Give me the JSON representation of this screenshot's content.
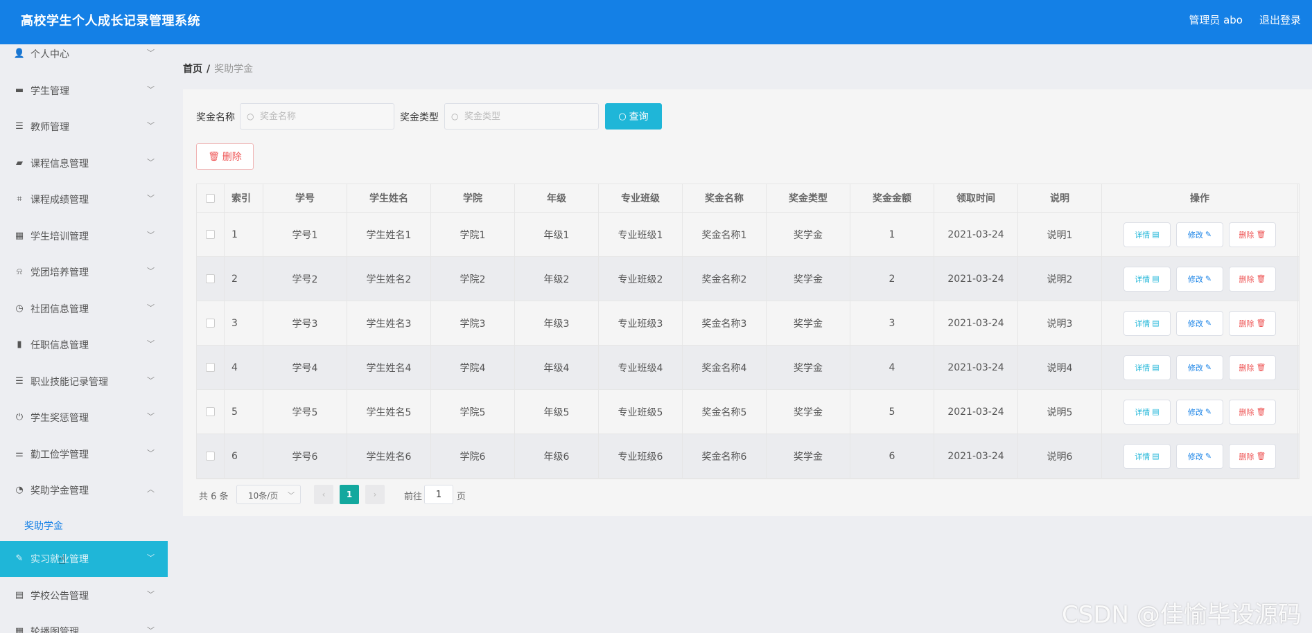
{
  "header": {
    "title": "高校学生个人成长记录管理系统",
    "user": "管理员 abo",
    "logout": "退出登录"
  },
  "sidebar": {
    "items": [
      {
        "label": "个人中心",
        "icon": "user-icon",
        "glyph": "👤",
        "chevron": "﹀"
      },
      {
        "label": "学生管理",
        "icon": "monitor-icon",
        "glyph": "▬",
        "chevron": "﹀"
      },
      {
        "label": "教师管理",
        "icon": "list-icon",
        "glyph": "☰",
        "chevron": "﹀"
      },
      {
        "label": "课程信息管理",
        "icon": "comment-icon",
        "glyph": "▰",
        "chevron": "﹀"
      },
      {
        "label": "课程成绩管理",
        "icon": "crop-icon",
        "glyph": "⌗",
        "chevron": "﹀"
      },
      {
        "label": "学生培训管理",
        "icon": "grid-icon",
        "glyph": "▦",
        "chevron": "﹀"
      },
      {
        "label": "党团培养管理",
        "icon": "bell-off-icon",
        "glyph": "⍾",
        "chevron": "﹀"
      },
      {
        "label": "社团信息管理",
        "icon": "clock-icon",
        "glyph": "◷",
        "chevron": "﹀"
      },
      {
        "label": "任职信息管理",
        "icon": "building-icon",
        "glyph": "▮",
        "chevron": "﹀"
      },
      {
        "label": "职业技能记录管理",
        "icon": "menu-icon",
        "glyph": "☰",
        "chevron": "﹀"
      },
      {
        "label": "学生奖惩管理",
        "icon": "power-icon",
        "glyph": "⏻",
        "chevron": "﹀"
      },
      {
        "label": "勤工俭学管理",
        "icon": "sliders-icon",
        "glyph": "⚌",
        "chevron": "﹀"
      },
      {
        "label": "奖助学金管理",
        "icon": "gauge-icon",
        "glyph": "◔",
        "chevron": "︿"
      }
    ],
    "subitem": "奖助学金",
    "hover_item": {
      "label": "实习就业管理",
      "icon": "pen-icon",
      "glyph": "✎",
      "chevron": "﹀"
    },
    "after_items": [
      {
        "label": "学校公告管理",
        "icon": "wallet-icon",
        "glyph": "▤",
        "chevron": "﹀"
      },
      {
        "label": "轮播图管理",
        "icon": "apps-icon",
        "glyph": "▦",
        "chevron": "﹀"
      }
    ],
    "cursor": "☝"
  },
  "breadcrumb": {
    "home": "首页",
    "sep": "/",
    "current": "奖助学金"
  },
  "search": {
    "name_label": "奖金名称",
    "name_placeholder": "奖金名称",
    "type_label": "奖金类型",
    "type_placeholder": "奖金类型",
    "query_button": "查询",
    "search_glyph": "○"
  },
  "actions": {
    "delete_button": "删除",
    "trash_glyph": "🗑"
  },
  "table": {
    "columns": [
      "索引",
      "学号",
      "学生姓名",
      "学院",
      "年级",
      "专业班级",
      "奖金名称",
      "奖金类型",
      "奖金金额",
      "领取时间",
      "说明",
      "操作"
    ],
    "rows": [
      [
        "1",
        "学号1",
        "学生姓名1",
        "学院1",
        "年级1",
        "专业班级1",
        "奖金名称1",
        "奖学金",
        "1",
        "2021-03-24",
        "说明1"
      ],
      [
        "2",
        "学号2",
        "学生姓名2",
        "学院2",
        "年级2",
        "专业班级2",
        "奖金名称2",
        "奖学金",
        "2",
        "2021-03-24",
        "说明2"
      ],
      [
        "3",
        "学号3",
        "学生姓名3",
        "学院3",
        "年级3",
        "专业班级3",
        "奖金名称3",
        "奖学金",
        "3",
        "2021-03-24",
        "说明3"
      ],
      [
        "4",
        "学号4",
        "学生姓名4",
        "学院4",
        "年级4",
        "专业班级4",
        "奖金名称4",
        "奖学金",
        "4",
        "2021-03-24",
        "说明4"
      ],
      [
        "5",
        "学号5",
        "学生姓名5",
        "学院5",
        "年级5",
        "专业班级5",
        "奖金名称5",
        "奖学金",
        "5",
        "2021-03-24",
        "说明5"
      ],
      [
        "6",
        "学号6",
        "学生姓名6",
        "学院6",
        "年级6",
        "专业班级6",
        "奖金名称6",
        "奖学金",
        "6",
        "2021-03-24",
        "说明6"
      ]
    ],
    "ops": {
      "detail": "详情",
      "detail_glyph": "▤",
      "edit": "修改",
      "edit_glyph": "✎",
      "delete": "删除",
      "delete_glyph": "🗑"
    }
  },
  "pagination": {
    "total": "共 6 条",
    "page_size": "10条/页",
    "size_chevron": "﹀",
    "prev": "‹",
    "current_page": "1",
    "next": "›",
    "goto_label": "前往",
    "goto_value": "1",
    "page_suffix": "页"
  },
  "watermark": "CSDN @佳愉毕设源码",
  "colors": {
    "header": "#1480e6",
    "accent": "#1fb6d8",
    "pager_active": "#13a89e",
    "danger": "#e55"
  }
}
